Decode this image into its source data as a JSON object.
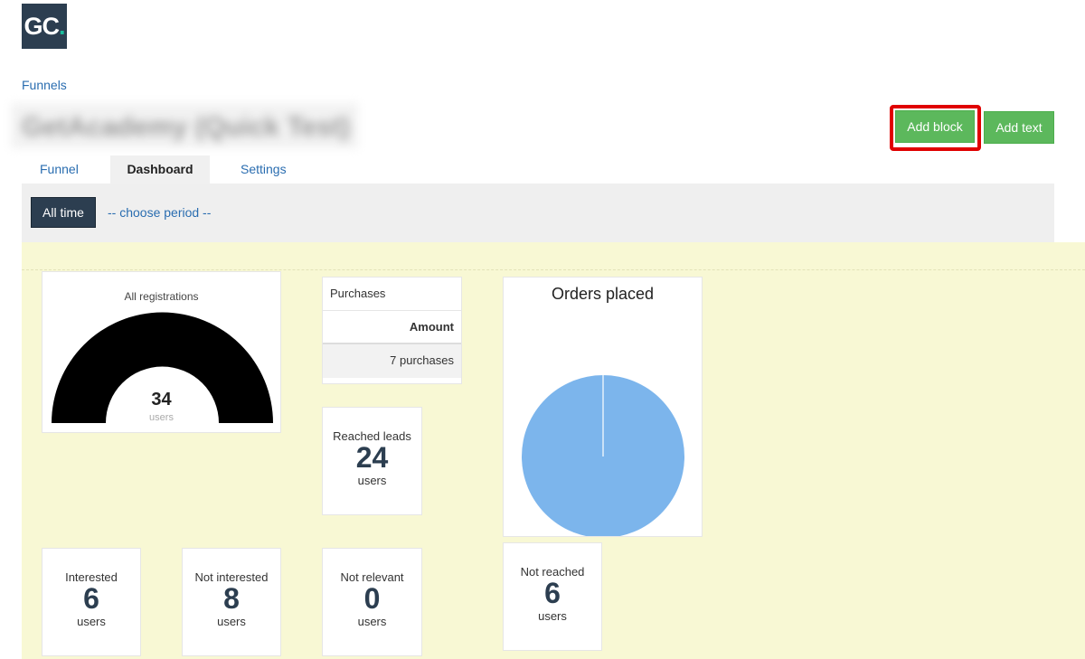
{
  "logo": {
    "text_main": "GC",
    "text_dot": "."
  },
  "breadcrumb": "Funnels",
  "page_title": "GetAcademy (Quick Test)",
  "toolbar": {
    "add_block_label": "Add block",
    "add_text_label": "Add text"
  },
  "tabs": [
    {
      "label": "Funnel",
      "active": false
    },
    {
      "label": "Dashboard",
      "active": true
    },
    {
      "label": "Settings",
      "active": false
    }
  ],
  "period": {
    "all_time_label": "All time",
    "choose_period_label": "-- choose period --"
  },
  "registrations": {
    "title": "All registrations",
    "value": "34",
    "unit": "users"
  },
  "purchases": {
    "title": "Purchases",
    "column": "Amount",
    "row": "7 purchases"
  },
  "orders": {
    "title": "Orders placed"
  },
  "chart_data": {
    "type": "pie",
    "title": "Orders placed",
    "values": [
      100
    ],
    "colors": [
      "#7cb5ec"
    ]
  },
  "stats": {
    "reached": {
      "label": "Reached leads",
      "value": "24",
      "unit": "users"
    },
    "interested": {
      "label": "Interested",
      "value": "6",
      "unit": "users"
    },
    "not_interested": {
      "label": "Not interested",
      "value": "8",
      "unit": "users"
    },
    "not_relevant": {
      "label": "Not relevant",
      "value": "0",
      "unit": "users"
    },
    "not_reached": {
      "label": "Not reached",
      "value": "6",
      "unit": "users"
    }
  },
  "colors": {
    "brand": "#2c3e50",
    "accent": "#1abc9c",
    "button_green": "#5cb85c",
    "highlight": "#e00000",
    "dashboard_bg": "#f8f8d4",
    "pie": "#7cb5ec"
  }
}
